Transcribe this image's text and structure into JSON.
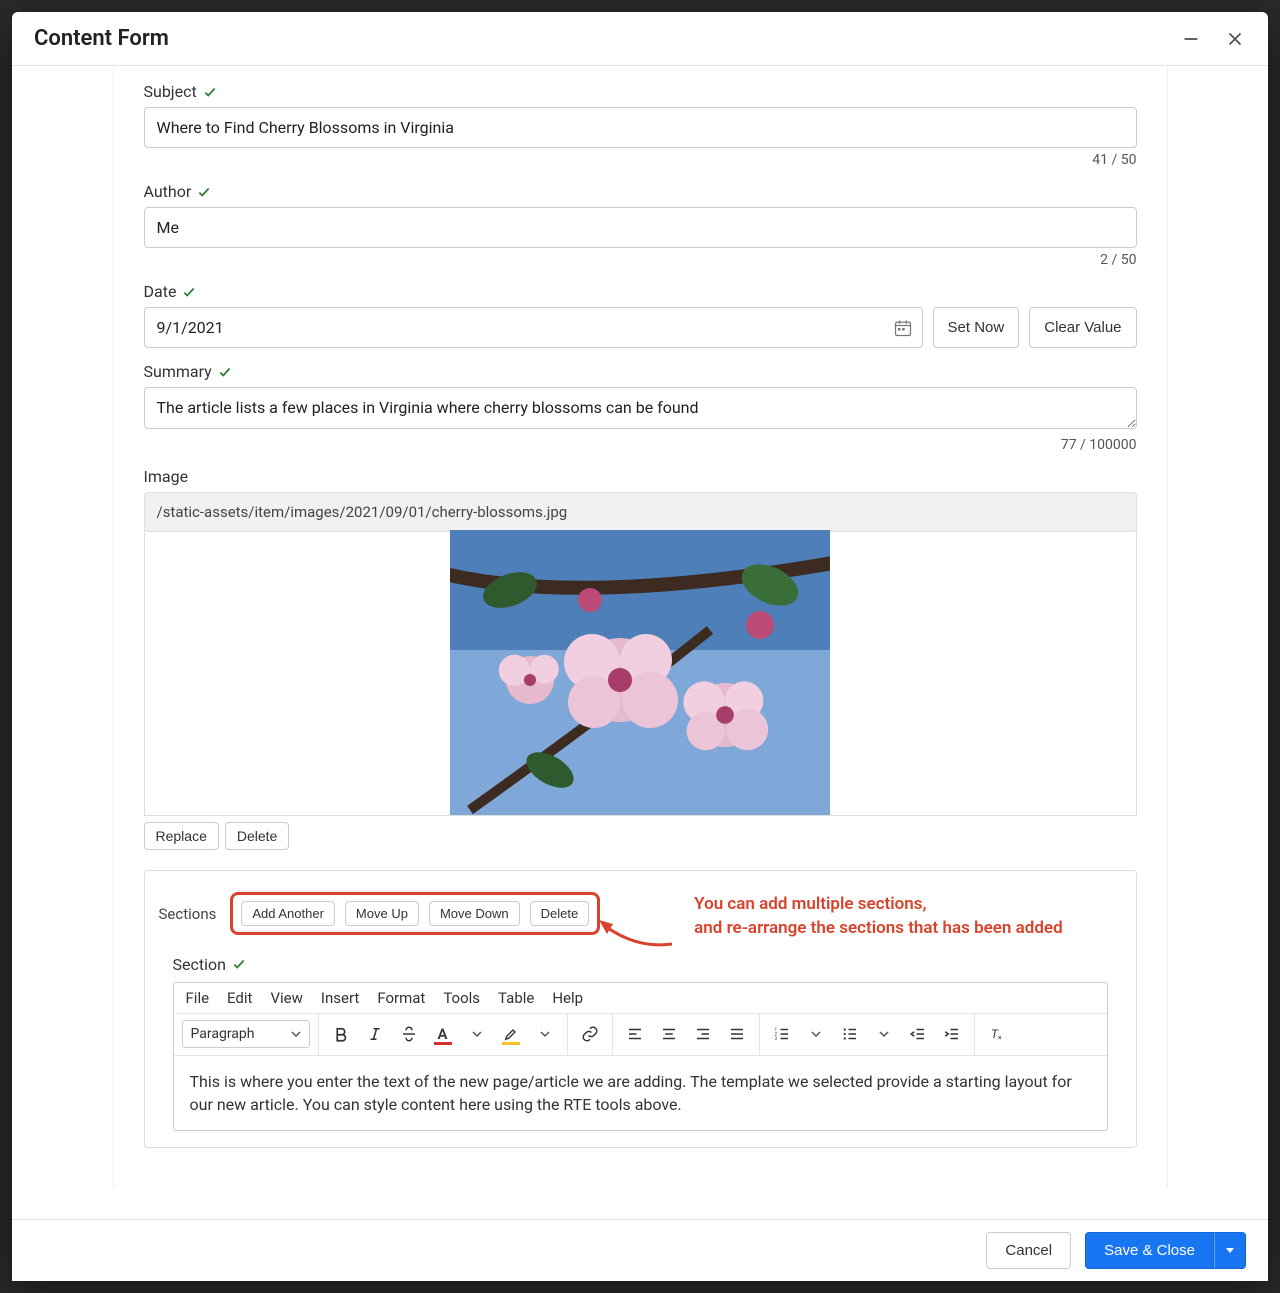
{
  "modal": {
    "title": "Content Form"
  },
  "fields": {
    "subject": {
      "label": "Subject",
      "value": "Where to Find Cherry Blossoms in Virginia",
      "counter": "41 / 50"
    },
    "author": {
      "label": "Author",
      "value": "Me",
      "counter": "2 / 50"
    },
    "date": {
      "label": "Date",
      "value": "9/1/2021",
      "set_now_label": "Set Now",
      "clear_label": "Clear Value"
    },
    "summary": {
      "label": "Summary",
      "value": "The article lists a few places in Virginia where cherry blossoms can be found",
      "counter": "77 / 100000"
    },
    "image": {
      "label": "Image",
      "path": "/static-assets/item/images/2021/09/01/cherry-blossoms.jpg",
      "replace_label": "Replace",
      "delete_label": "Delete"
    }
  },
  "sections": {
    "group_label": "Sections",
    "buttons": {
      "add": "Add Another",
      "move_up": "Move Up",
      "move_down": "Move Down",
      "delete": "Delete"
    },
    "section_label": "Section",
    "rte": {
      "menus": [
        "File",
        "Edit",
        "View",
        "Insert",
        "Format",
        "Tools",
        "Table",
        "Help"
      ],
      "style_select": "Paragraph",
      "content": "This is where you enter the text of the new page/article we are adding.  The template we selected provide a starting layout for our new article.  You can style content here using the RTE tools above."
    }
  },
  "annotation": {
    "line1": "You can add multiple sections,",
    "line2": "and re-arrange the sections that has been added"
  },
  "footer": {
    "cancel": "Cancel",
    "save": "Save & Close"
  }
}
